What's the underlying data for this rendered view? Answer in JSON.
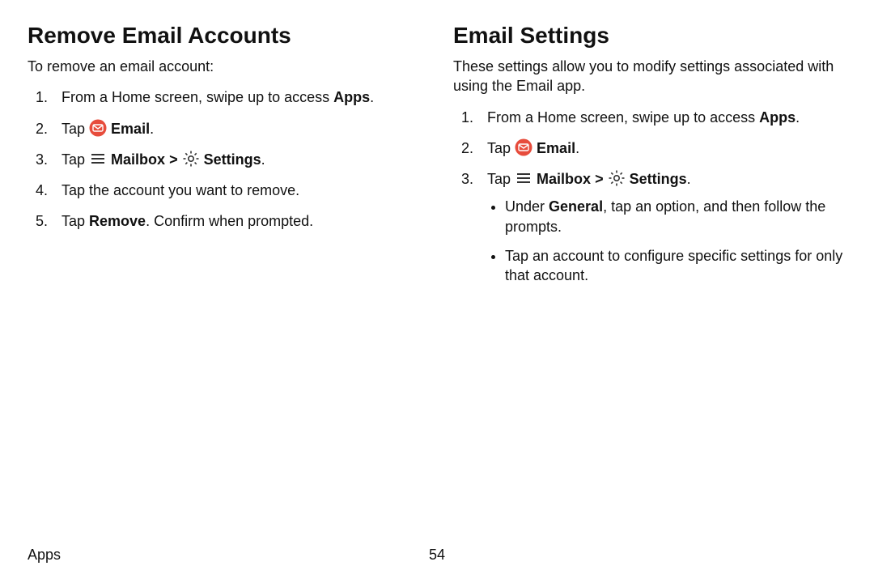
{
  "left": {
    "heading": "Remove Email Accounts",
    "intro": "To remove an email account:",
    "steps": [
      {
        "pre": "From a Home screen, swipe up to access ",
        "b1": "Apps",
        "post": "."
      },
      {
        "pre": "Tap ",
        "icon": "email",
        "b1": "Email",
        "post": "."
      },
      {
        "pre": "Tap ",
        "icon": "hamburger",
        "b1": "Mailbox",
        "mid": " ",
        "caret": ">",
        "mid2": " ",
        "icon2": "gear",
        "b2": "Settings",
        "post": "."
      },
      {
        "pre": "Tap the account you want to remove."
      },
      {
        "pre": "Tap ",
        "b1": "Remove",
        "post": ". Confirm when prompted."
      }
    ]
  },
  "right": {
    "heading": "Email Settings",
    "intro": "These settings allow you to modify settings associated with using the Email app.",
    "steps": [
      {
        "pre": "From a Home screen, swipe up to access ",
        "b1": "Apps",
        "post": "."
      },
      {
        "pre": "Tap ",
        "icon": "email",
        "b1": "Email",
        "post": "."
      },
      {
        "pre": "Tap ",
        "icon": "hamburger",
        "b1": "Mailbox",
        "mid": " ",
        "caret": ">",
        "mid2": " ",
        "icon2": "gear",
        "b2": "Settings",
        "post": "."
      }
    ],
    "sub": [
      {
        "pre": "Under ",
        "b1": "General",
        "post": ", tap an option, and then follow the prompts."
      },
      {
        "pre": "Tap an account to configure specific settings for only that account."
      }
    ]
  },
  "footer": {
    "section": "Apps",
    "page": "54"
  },
  "colors": {
    "email_icon": "#e74c3c"
  }
}
